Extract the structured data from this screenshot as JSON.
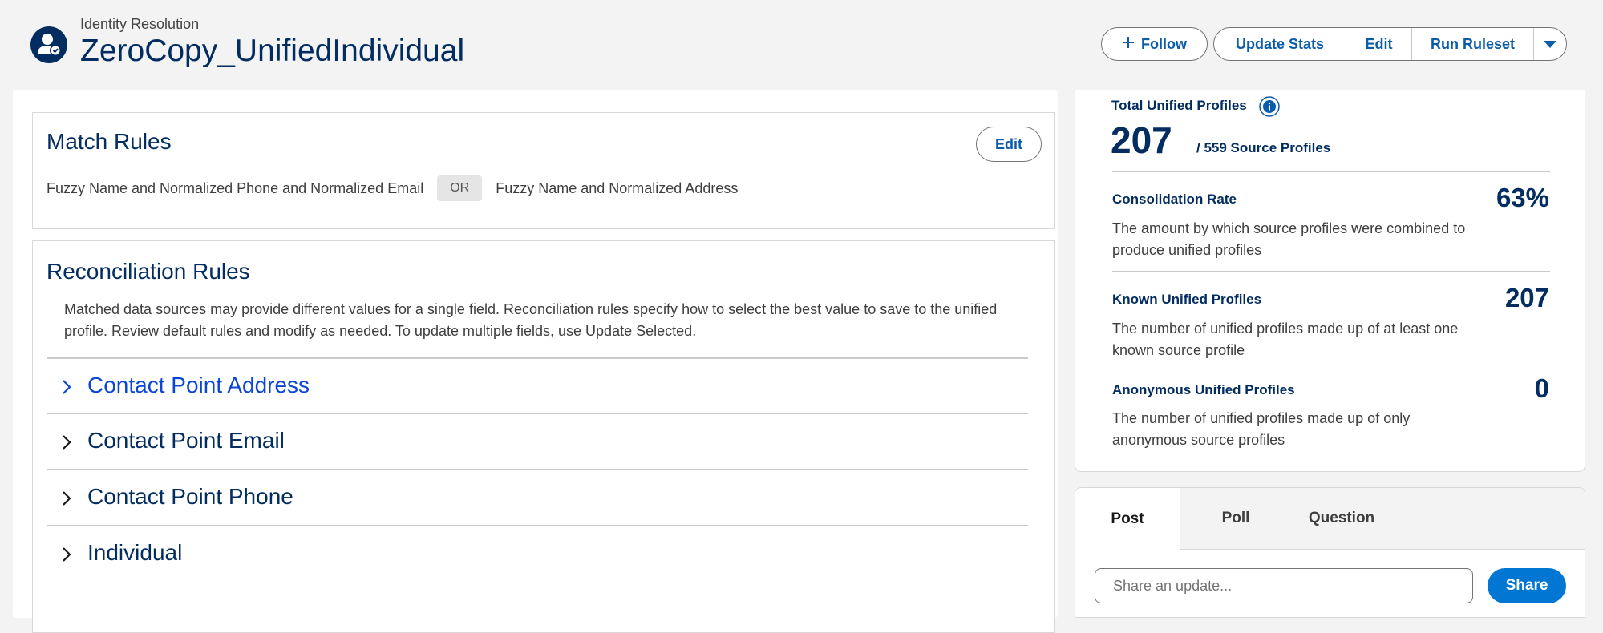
{
  "header": {
    "eyebrow": "Identity Resolution",
    "title": "ZeroCopy_UnifiedIndividual",
    "follow_label": "Follow",
    "actions": [
      "Update Stats",
      "Edit",
      "Run Ruleset"
    ]
  },
  "match_rules": {
    "title": "Match Rules",
    "edit_label": "Edit",
    "rule_a": "Fuzzy Name and Normalized Phone and Normalized Email",
    "or_label": "OR",
    "rule_b": "Fuzzy Name and Normalized Address"
  },
  "reconciliation_rules": {
    "title": "Reconciliation Rules",
    "description": "Matched data sources may provide different values for a single field. Reconciliation rules specify how to select the best value to save to the unified profile. Review default rules and modify as needed. To update multiple fields, use Update Selected.",
    "sections": [
      "Contact Point Address",
      "Contact Point Email",
      "Contact Point Phone",
      "Individual"
    ]
  },
  "stats": {
    "total_label": "Total Unified Profiles",
    "total_value": "207",
    "total_suffix": "/ 559 Source Profiles",
    "consolidation_label": "Consolidation Rate",
    "consolidation_value": "63%",
    "consolidation_desc": "The amount by which source profiles were combined to produce unified profiles",
    "known_label": "Known Unified Profiles",
    "known_value": "207",
    "known_desc": "The number of unified profiles made up of at least one known source profile",
    "anon_label": "Anonymous Unified Profiles",
    "anon_value": "0",
    "anon_desc": "The number of unified profiles made up of only anonymous source profiles"
  },
  "publisher": {
    "tabs": [
      "Post",
      "Poll",
      "Question"
    ],
    "placeholder": "Share an update...",
    "share_label": "Share"
  },
  "colors": {
    "brand": "#032d60",
    "link": "#0b5cab",
    "primary": "#0176d3"
  }
}
